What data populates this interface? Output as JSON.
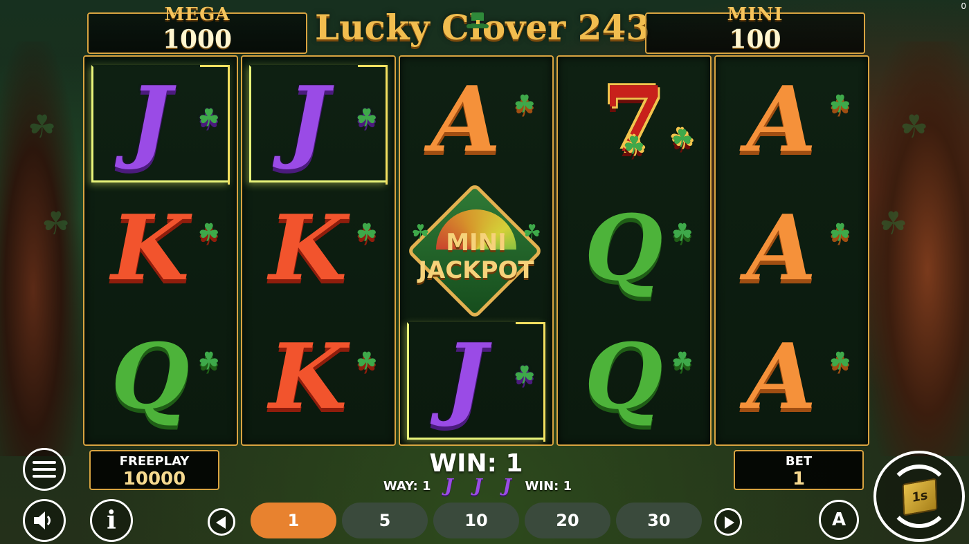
{
  "corner_counter": "0",
  "jackpots": {
    "mega": {
      "label": "MEGA",
      "value": "1000"
    },
    "mini": {
      "label": "MINI",
      "value": "100"
    }
  },
  "logo": {
    "text": "Lucky Clover 243"
  },
  "reels": [
    {
      "cells": [
        {
          "symbol": "J",
          "win": true
        },
        {
          "symbol": "K",
          "win": false
        },
        {
          "symbol": "Q",
          "win": false
        }
      ]
    },
    {
      "cells": [
        {
          "symbol": "J",
          "win": true
        },
        {
          "symbol": "K",
          "win": false
        },
        {
          "symbol": "K",
          "win": false
        }
      ]
    },
    {
      "cells": [
        {
          "symbol": "A",
          "win": false
        },
        {
          "symbol": "MINI JACKPOT",
          "win": false
        },
        {
          "symbol": "J",
          "win": true
        }
      ]
    },
    {
      "cells": [
        {
          "symbol": "7",
          "win": false
        },
        {
          "symbol": "Q",
          "win": false
        },
        {
          "symbol": "Q",
          "win": false
        }
      ]
    },
    {
      "cells": [
        {
          "symbol": "A",
          "win": false
        },
        {
          "symbol": "A",
          "win": false
        },
        {
          "symbol": "A",
          "win": false
        }
      ]
    }
  ],
  "mini_jackpot_symbol": {
    "line1": "MINI",
    "line2": "JACKPOT"
  },
  "freeplay": {
    "label": "FREEPLAY",
    "value": "10000"
  },
  "bet": {
    "label": "BET",
    "value": "1"
  },
  "win": {
    "main": "WIN: 1",
    "way_label": "WAY: 1",
    "symbols": [
      "J",
      "J",
      "J"
    ],
    "win_label": "WIN: 1"
  },
  "bet_options": [
    {
      "label": "1",
      "active": true
    },
    {
      "label": "5",
      "active": false
    },
    {
      "label": "10",
      "active": false
    },
    {
      "label": "20",
      "active": false
    },
    {
      "label": "30",
      "active": false
    }
  ],
  "buttons": {
    "menu_icon": "hamburger-menu-icon",
    "sound_icon": "speaker-icon",
    "info_icon": "info-icon",
    "info_glyph": "i",
    "autoplay_glyph": "A",
    "spin_glyph": "1s"
  },
  "colors": {
    "gold_border": "#d9a441",
    "active_bet": "#e8822f",
    "inactive_bet": "#3a4a3c"
  }
}
